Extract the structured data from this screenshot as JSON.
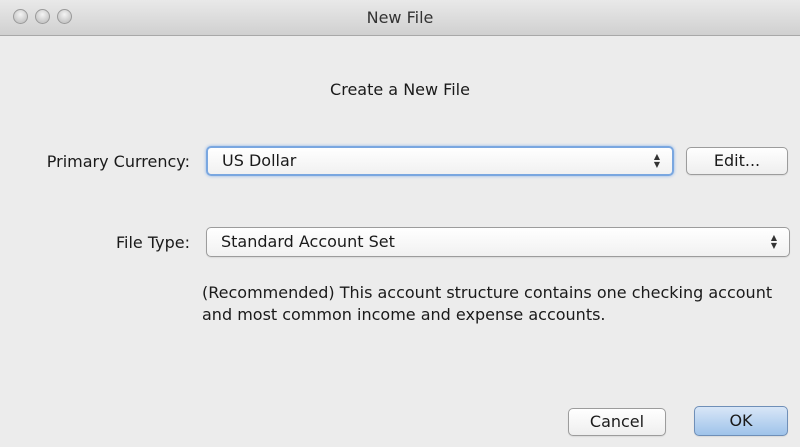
{
  "window": {
    "title": "New File"
  },
  "dialog": {
    "heading": "Create a New File",
    "currency": {
      "label": "Primary Currency:",
      "selected": "US Dollar",
      "edit_label": "Edit..."
    },
    "file_type": {
      "label": "File Type:",
      "selected": "Standard Account Set"
    },
    "description": "(Recommended)  This account structure contains one checking account and most common income and expense accounts.",
    "buttons": {
      "cancel": "Cancel",
      "ok": "OK"
    }
  },
  "colors": {
    "focus_ring": "#7aa7e0",
    "default_button": "#9fc3ea",
    "window_bg": "#ececec"
  },
  "icons": {
    "stepper": "up-down-arrows-icon"
  }
}
